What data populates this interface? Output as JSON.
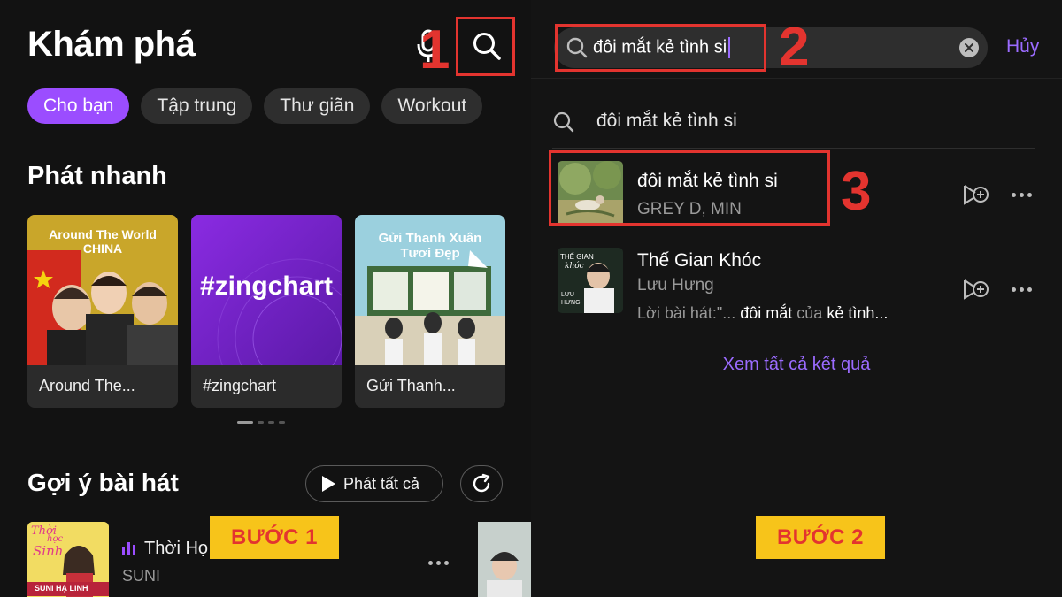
{
  "left": {
    "title": "Khám phá",
    "icons": {
      "mic": "microphone-icon",
      "search": "search-icon"
    },
    "chips": [
      "Cho bạn",
      "Tập trung",
      "Thư giãn",
      "Workout"
    ],
    "quick_play": {
      "title": "Phát nhanh",
      "cards": [
        {
          "art_line1": "Around The World",
          "art_line2": "CHINA",
          "caption": "Around The..."
        },
        {
          "art_line1": "#zingchart",
          "caption": "#zingchart"
        },
        {
          "art_line1": "Gửi Thanh Xuân",
          "art_line2": "Tươi Đẹp",
          "caption": "Gửi Thanh..."
        }
      ]
    },
    "suggest": {
      "title": "Gợi ý bài hát",
      "play_all": "Phát tất cả",
      "song": {
        "title": "Thời Họ",
        "artist": "SUNI",
        "thumb_line1": "Thời",
        "thumb_line2": "học",
        "thumb_line3": "Sinh",
        "thumb_name": "SUNI HẠ LINH"
      }
    },
    "badge": "BƯỚC 1",
    "step": "1"
  },
  "right": {
    "search": {
      "value": "đôi mắt kẻ tình si",
      "cancel": "Hủy"
    },
    "suggestion": "đôi mắt kẻ tình si",
    "results": [
      {
        "title": "đôi mắt kẻ tình si",
        "artist": "GREY D, MIN"
      },
      {
        "title": "Thế Gian Khóc",
        "artist": "Lưu Hưng",
        "lyric_prefix": "Lời bài hát:\"... ",
        "lyric_m1": "đôi mắt",
        "lyric_mid": " của ",
        "lyric_m2": "kẻ tình...",
        "thumb_line1": "THẾ GIAN",
        "thumb_line2": "khóc",
        "thumb_line3": "LƯU",
        "thumb_line4": "HƯNG"
      }
    ],
    "see_all": "Xem tất cả kết quả",
    "badge": "BƯỚC 2",
    "steps": [
      "2",
      "3"
    ]
  },
  "colors": {
    "accent": "#9b4dff",
    "highlight": "#e3342f",
    "badge_bg": "#f7c41a"
  }
}
